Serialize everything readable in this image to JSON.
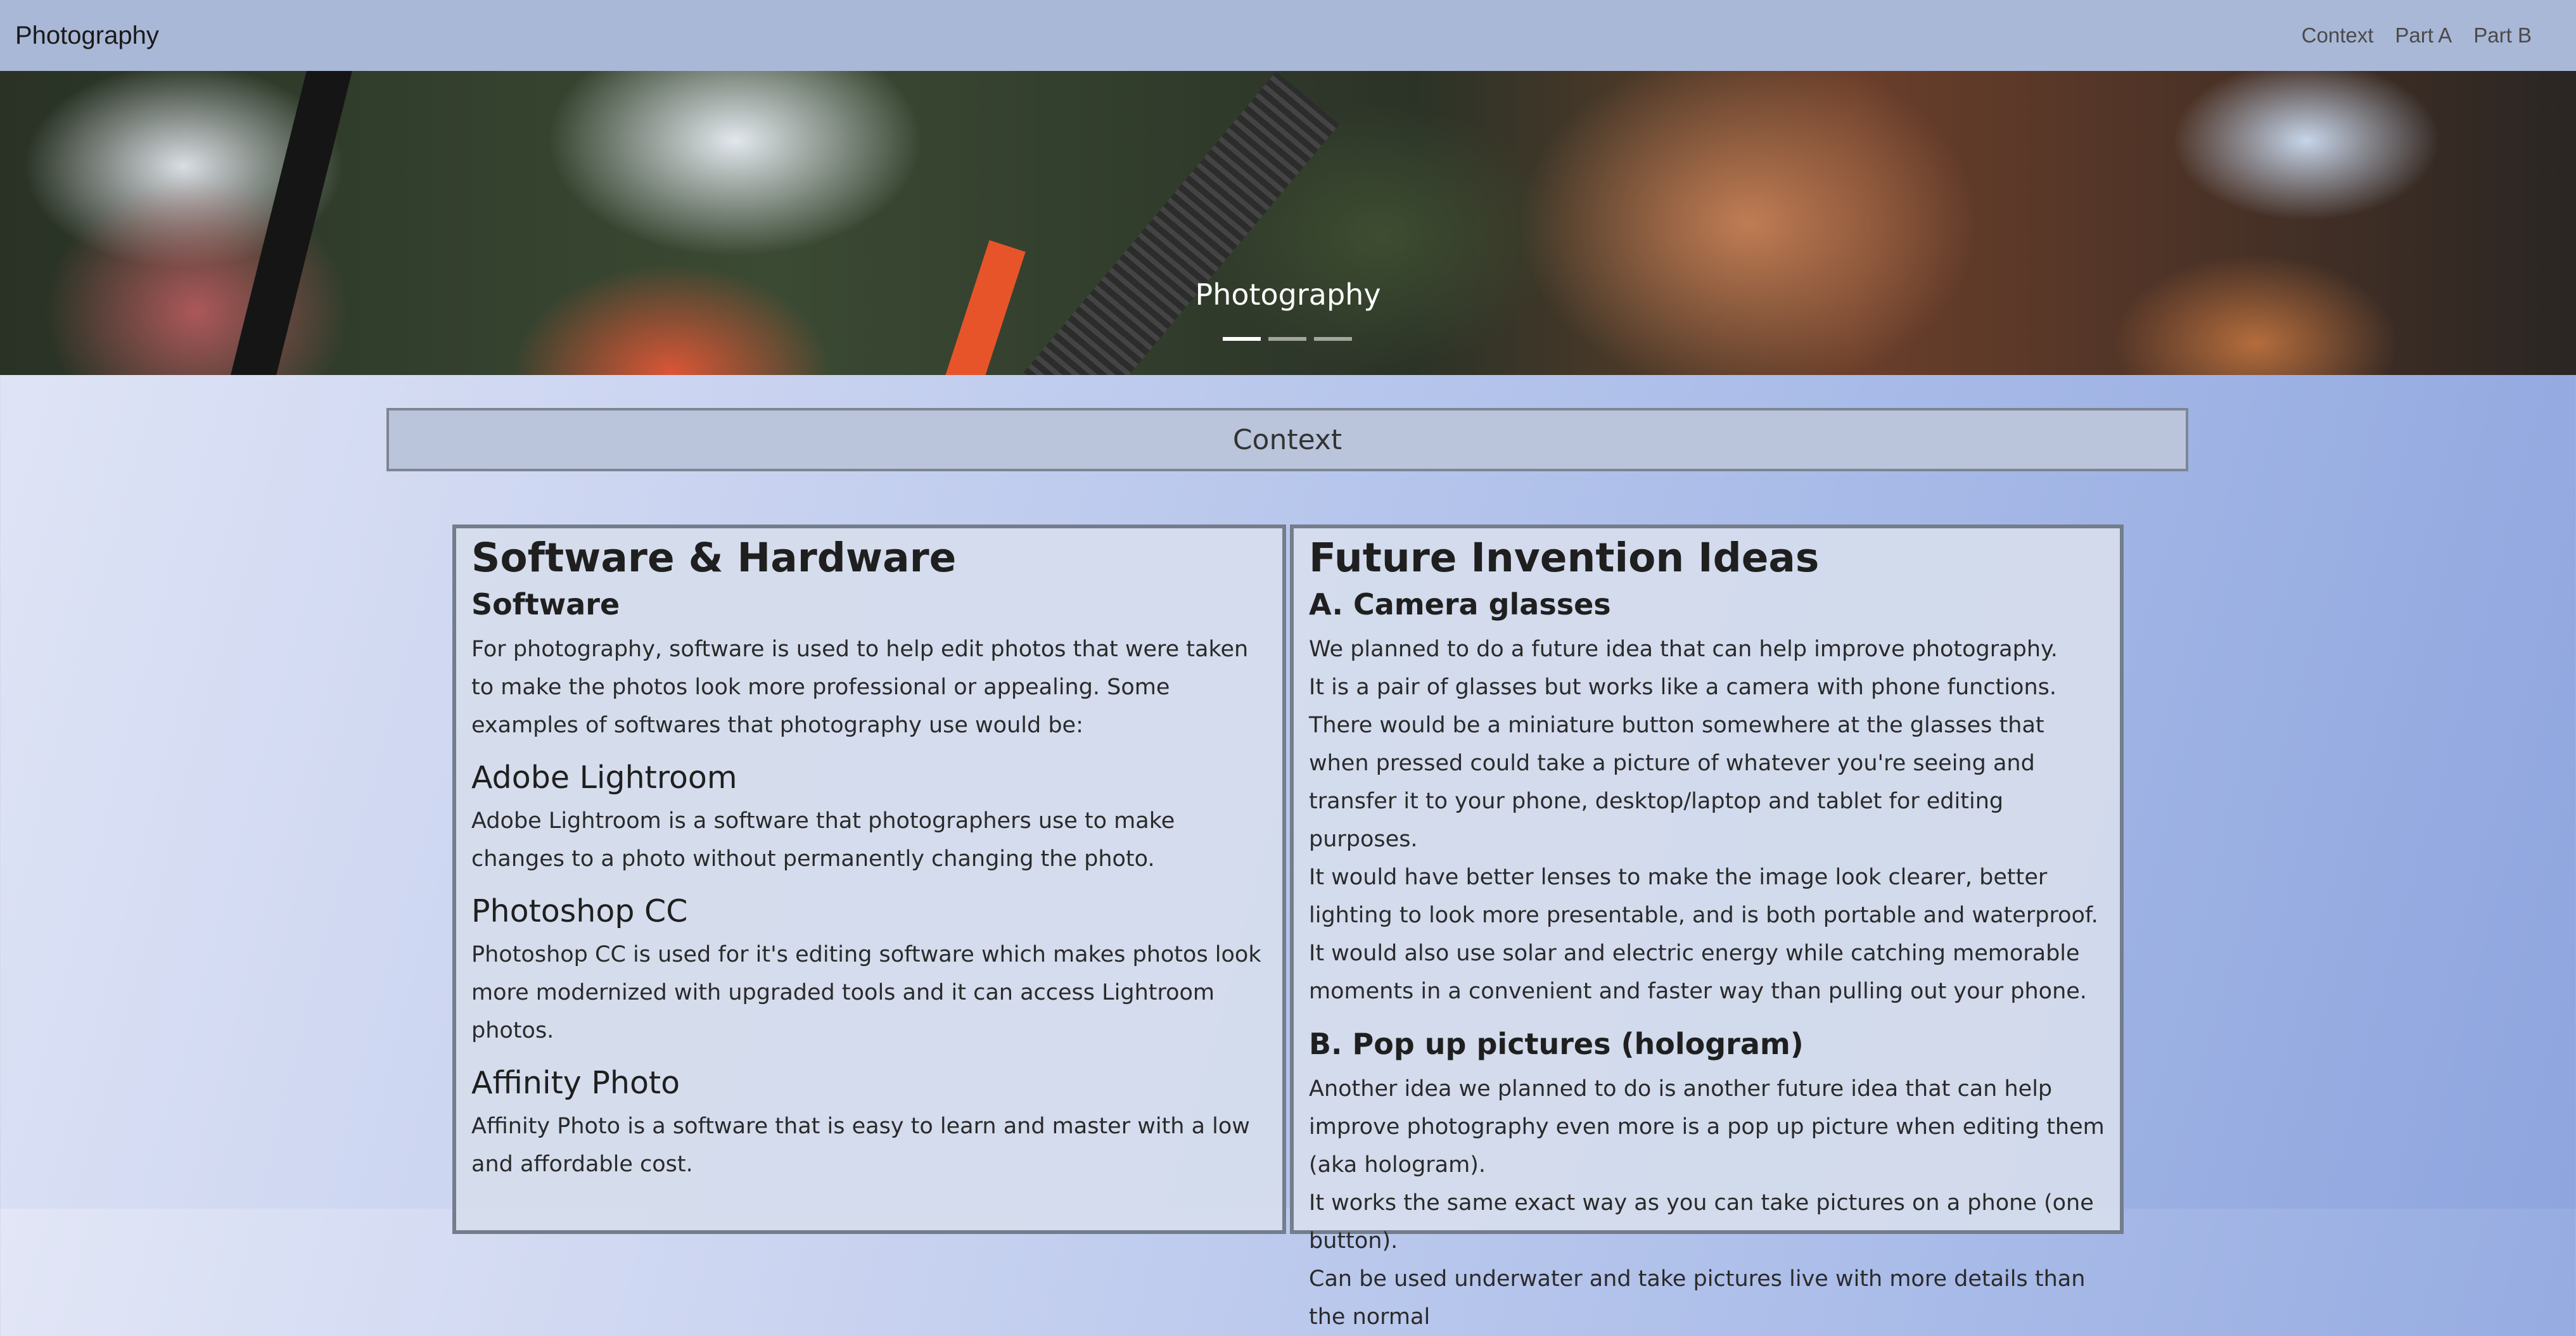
{
  "navbar": {
    "brand": "Photography",
    "links": [
      "Context",
      "Part A",
      "Part B"
    ]
  },
  "hero": {
    "caption": "Photography",
    "indicator_count": 3,
    "active_indicator": 0
  },
  "context": {
    "label": "Context"
  },
  "software_section": {
    "title": "Software & Hardware",
    "subtitle": "Software",
    "intro": "For photography, software is used to help edit photos that were taken to make the photos look more professional or appealing. Some examples of softwares that photography use would be:",
    "items": [
      {
        "name": "Adobe Lightroom",
        "desc": "Adobe Lightroom is a software that photographers use to make changes to a photo without permanently changing the photo."
      },
      {
        "name": "Photoshop CC",
        "desc": "Photoshop CC is used for it's editing software which makes photos look more modernized with upgraded tools and it can access Lightroom photos."
      },
      {
        "name": "Affinity Photo",
        "desc": "Affinity Photo is a software that is easy to learn and master with a low and affordable cost."
      }
    ]
  },
  "future_section": {
    "title": "Future Invention Ideas",
    "idea_a": {
      "heading": "A. Camera glasses",
      "lines": [
        "We planned to do a future idea that can help improve photography.",
        "It is a pair of glasses but works like a camera with phone functions.",
        "There would be a miniature button somewhere at the glasses that when pressed could take a picture of whatever you're seeing and transfer it to your phone, desktop/laptop and tablet for editing purposes.",
        "It would have better lenses to make the image look clearer, better lighting to look more presentable, and is both portable and waterproof.",
        "It would also use solar and electric energy while catching memorable moments in a convenient and faster way than pulling out your phone."
      ]
    },
    "idea_b": {
      "heading": "B. Pop up pictures (hologram)",
      "lines": [
        "Another idea we planned to do is another future idea that can help improve photography even more is a pop up picture when editing them (aka hologram).",
        "It works the same exact way as you can take pictures on a phone (one button).",
        "Can be used underwater and take pictures live with more details than the normal"
      ]
    }
  }
}
